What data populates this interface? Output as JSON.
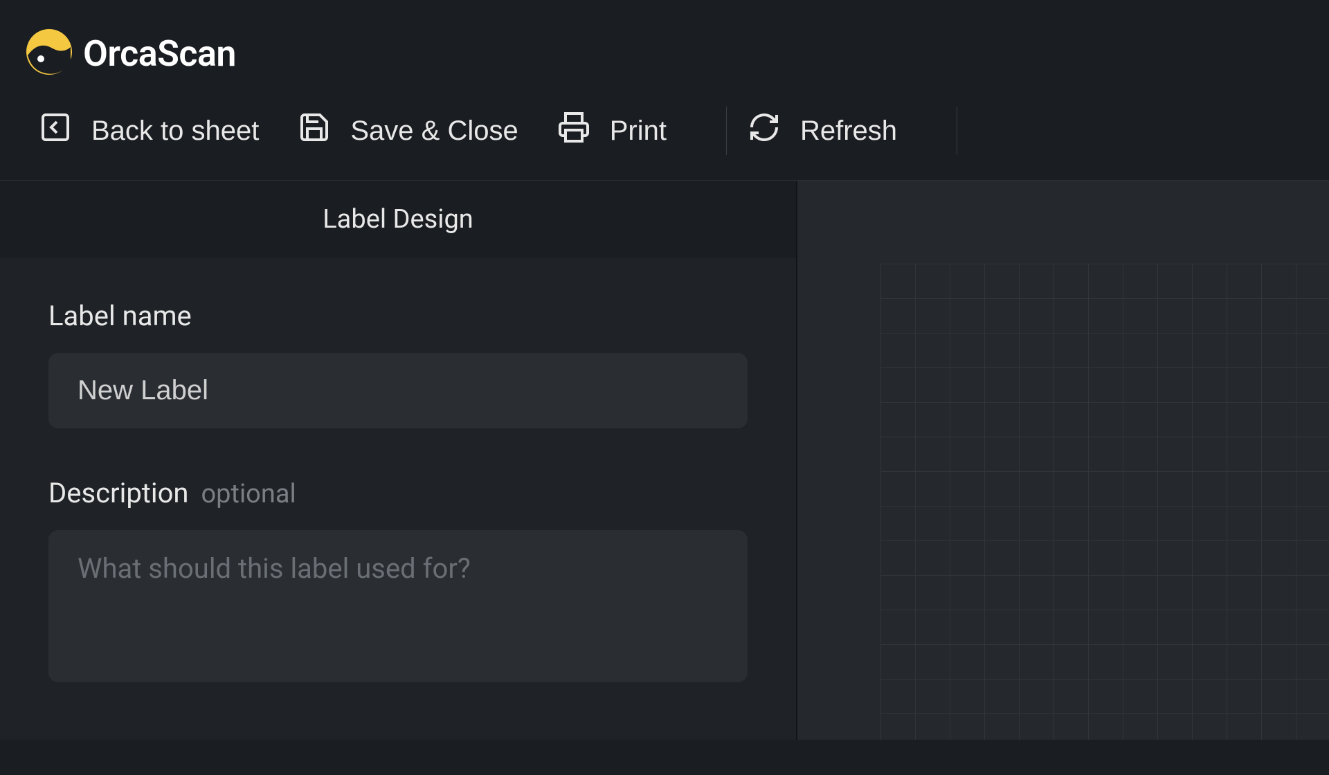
{
  "brand": {
    "name": "OrcaScan"
  },
  "toolbar": {
    "back": "Back to sheet",
    "save": "Save & Close",
    "print": "Print",
    "refresh": "Refresh"
  },
  "panel": {
    "title": "Label Design",
    "label_name_label": "Label name",
    "label_name_value": "New Label",
    "description_label": "Description",
    "description_optional": "optional",
    "description_placeholder": "What should this label used for?"
  }
}
